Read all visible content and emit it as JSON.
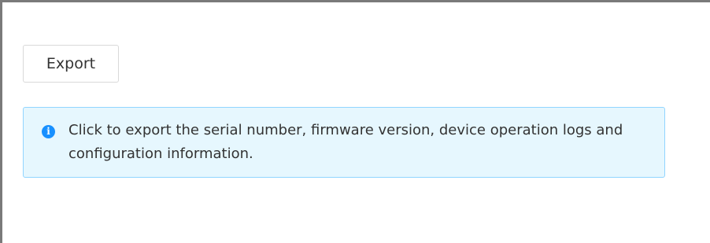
{
  "toolbar": {
    "export_label": "Export"
  },
  "info_notice": {
    "icon": "info-icon",
    "message": "Click to export the serial number, firmware version, device operation logs and configuration information.",
    "accent_color": "#1890ff",
    "background_color": "#e6f7fe",
    "border_color": "#91d5ff"
  }
}
